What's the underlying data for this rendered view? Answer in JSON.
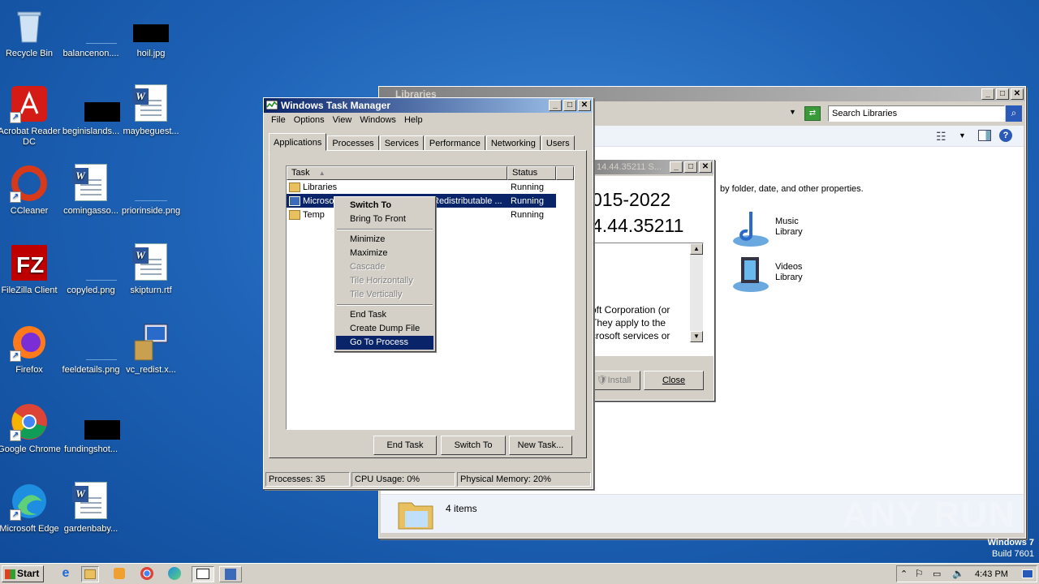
{
  "desktop": {
    "icons": [
      {
        "label": "Recycle Bin",
        "icon": "recycle-bin-icon"
      },
      {
        "label": "balancenon....",
        "icon": "image-file-icon"
      },
      {
        "label": "hoil.jpg",
        "icon": "image-file-icon"
      },
      {
        "label": "Acrobat Reader DC",
        "icon": "acrobat-icon"
      },
      {
        "label": "beginislands...",
        "icon": "image-file-icon"
      },
      {
        "label": "maybeguest...",
        "icon": "word-doc-icon"
      },
      {
        "label": "CCleaner",
        "icon": "ccleaner-icon"
      },
      {
        "label": "comingasso...",
        "icon": "word-doc-icon"
      },
      {
        "label": "priorinside.png",
        "icon": "image-file-icon"
      },
      {
        "label": "FileZilla Client",
        "icon": "filezilla-icon"
      },
      {
        "label": "copyled.png",
        "icon": "image-file-icon"
      },
      {
        "label": "skipturn.rtf",
        "icon": "word-doc-icon"
      },
      {
        "label": "Firefox",
        "icon": "firefox-icon"
      },
      {
        "label": "feeldetails.png",
        "icon": "image-file-icon"
      },
      {
        "label": "vc_redist.x...",
        "icon": "installer-icon"
      },
      {
        "label": "Google Chrome",
        "icon": "chrome-icon"
      },
      {
        "label": "fundingshot...",
        "icon": "image-file-icon"
      },
      {
        "label": "Microsoft Edge",
        "icon": "edge-icon"
      },
      {
        "label": "gardenbaby...",
        "icon": "word-doc-icon"
      }
    ]
  },
  "libraries": {
    "title": "Libraries",
    "search_placeholder": "Search Libraries",
    "description": "by folder, date, and other properties.",
    "items": [
      {
        "line1": "Music",
        "line2": "Library"
      },
      {
        "line1": "Videos",
        "line2": "Library"
      }
    ],
    "footer_count": "4 items"
  },
  "installer": {
    "title": "14.44.35211 S...",
    "heading1": "015-2022",
    "heading2": "4.44.35211",
    "license_lines": [
      "oft Corporation (or",
      "They apply to the",
      "crosoft services or"
    ],
    "install_label": "Install",
    "close_label": "Close"
  },
  "taskmgr": {
    "title": "Windows Task Manager",
    "menu": [
      "File",
      "Options",
      "View",
      "Windows",
      "Help"
    ],
    "tabs": [
      "Applications",
      "Processes",
      "Services",
      "Performance",
      "Networking",
      "Users"
    ],
    "columns": {
      "task": "Task",
      "status": "Status"
    },
    "rows": [
      {
        "task": "Libraries",
        "status": "Running"
      },
      {
        "task": "Microsoft Visual C++ 2015-2022 Redistributable ...",
        "status": "Running"
      },
      {
        "task": "Temp",
        "status": "Running"
      }
    ],
    "buttons": {
      "end_task": "End Task",
      "switch_to": "Switch To",
      "new_task": "New Task..."
    },
    "status": {
      "processes": "Processes: 35",
      "cpu": "CPU Usage: 0%",
      "memory": "Physical Memory: 20%"
    }
  },
  "context_menu": {
    "items": [
      {
        "label": "Switch To",
        "state": "bold"
      },
      {
        "label": "Bring To Front",
        "state": "normal"
      },
      {
        "label": "Minimize",
        "state": "normal"
      },
      {
        "label": "Maximize",
        "state": "normal"
      },
      {
        "label": "Cascade",
        "state": "disabled"
      },
      {
        "label": "Tile Horizontally",
        "state": "disabled"
      },
      {
        "label": "Tile Vertically",
        "state": "disabled"
      },
      {
        "label": "End Task",
        "state": "normal"
      },
      {
        "label": "Create Dump File",
        "state": "normal"
      },
      {
        "label": "Go To Process",
        "state": "highlighted"
      }
    ]
  },
  "watermark": {
    "text": "ANY RUN",
    "os": "Windows 7",
    "build": "Build 7601"
  },
  "taskbar": {
    "start_label": "Start",
    "clock": "4:43 PM"
  }
}
